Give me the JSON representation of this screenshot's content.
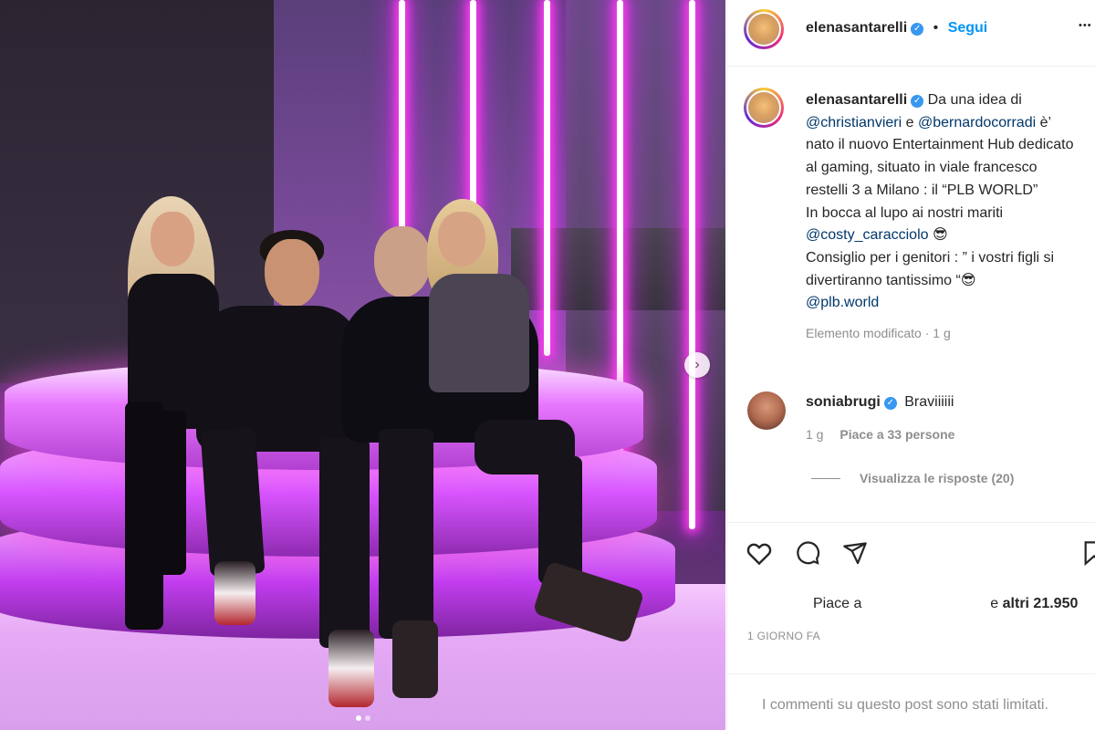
{
  "post": {
    "carousel": {
      "total_slides": 2,
      "active_slide": 1
    }
  },
  "author": {
    "username": "elenasantarelli",
    "verified_mark": "✓",
    "separator": "•",
    "follow_label": "Segui",
    "more_label": "•••"
  },
  "caption": {
    "username": "elenasantarelli",
    "segments": [
      {
        "text": "Da una idea di ",
        "type": "text"
      },
      {
        "text": "@christianvieri",
        "type": "mention"
      },
      {
        "text": " e ",
        "type": "text"
      },
      {
        "text": "@bernardocorradi",
        "type": "mention"
      },
      {
        "text": " è’ nato il nuovo Entertainment Hub dedicato al gaming, situato in viale francesco restelli 3 a Milano : il “PLB WORLD”",
        "type": "text"
      },
      {
        "text": "\n",
        "type": "break"
      },
      {
        "text": "In bocca al lupo ai nostri mariti ",
        "type": "text"
      },
      {
        "text": "\n",
        "type": "break"
      },
      {
        "text": "@costy_caracciolo",
        "type": "mention"
      },
      {
        "text": " 😎",
        "type": "text"
      },
      {
        "text": "\n",
        "type": "break"
      },
      {
        "text": "Consiglio per i genitori : ” i vostri figli si divertiranno tantissimo “😎",
        "type": "text"
      },
      {
        "text": "\n",
        "type": "break"
      },
      {
        "text": "@plb.world",
        "type": "mention"
      }
    ],
    "edited_label": "Elemento modificato",
    "edited_age": "1 g"
  },
  "comment": {
    "username": "soniabrugi",
    "text": "Braviiiiii",
    "age": "1 g",
    "likes": "Piace a 33 persone",
    "view_replies": "Visualizza le risposte (20)"
  },
  "likes": {
    "prefix": "Piace a",
    "suffix_text": "e",
    "others": "altri 21.950"
  },
  "timestamp": "1 GIORNO FA",
  "comments_limited": "I commenti su questo post sono stati limitati."
}
